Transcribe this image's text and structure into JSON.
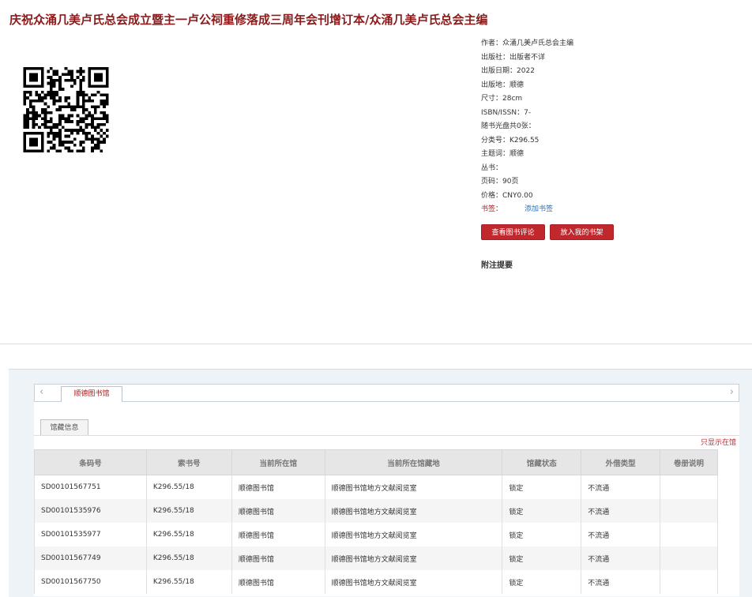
{
  "book": {
    "title": "庆祝众涌几美卢氏总会成立暨主一卢公祠重修落成三周年会刊增订本/众涌几美卢氏总会主编",
    "meta": [
      {
        "label": "作者：",
        "value": "众涌几美卢氏总会主编"
      },
      {
        "label": "出版社：",
        "value": "出版者不详"
      },
      {
        "label": "出版日期：",
        "value": "2022"
      },
      {
        "label": "出版地：",
        "value": "顺德"
      },
      {
        "label": "尺寸：",
        "value": "28cm"
      },
      {
        "label": "ISBN/ISSN：",
        "value": "7-"
      },
      {
        "label": "随书光盘共0张：",
        "value": ""
      },
      {
        "label": "分类号：",
        "value": "K296.55"
      },
      {
        "label": "主题词：",
        "value": "顺德"
      },
      {
        "label": "丛书：",
        "value": ""
      },
      {
        "label": "页码：",
        "value": "90页"
      },
      {
        "label": "价格：",
        "value": "CNY0.00"
      }
    ],
    "tag_label": "书签：",
    "add_tag": "添加书签",
    "review_button": "查看图书评论",
    "shelf_button": "放入我的书架",
    "notes_heading": "附注提要"
  },
  "holdings": {
    "library_tab": "顺德图书馆",
    "sub_tab": "馆藏信息",
    "only_link": "只显示在馆",
    "arrow_left": "‹",
    "arrow_right": "›",
    "columns": [
      "条码号",
      "索书号",
      "当前所在馆",
      "当前所在馆藏地",
      "馆藏状态",
      "外借类型",
      "卷册说明"
    ],
    "rows": [
      [
        "SD00101567751",
        "K296.55/18",
        "顺德图书馆",
        "顺德图书馆地方文献阅览室",
        "锁定",
        "不流通",
        ""
      ],
      [
        "SD00101535976",
        "K296.55/18",
        "顺德图书馆",
        "顺德图书馆地方文献阅览室",
        "锁定",
        "不流通",
        ""
      ],
      [
        "SD00101535977",
        "K296.55/18",
        "顺德图书馆",
        "顺德图书馆地方文献阅览室",
        "锁定",
        "不流通",
        ""
      ],
      [
        "SD00101567749",
        "K296.55/18",
        "顺德图书馆",
        "顺德图书馆地方文献阅览室",
        "锁定",
        "不流通",
        ""
      ],
      [
        "SD00101567750",
        "K296.55/18",
        "顺德图书馆",
        "顺德图书馆地方文献阅览室",
        "锁定",
        "不流通",
        ""
      ]
    ]
  },
  "colors": {
    "accent": "#c0282d",
    "title": "#8b1a1a",
    "link": "#2a6fb5"
  }
}
